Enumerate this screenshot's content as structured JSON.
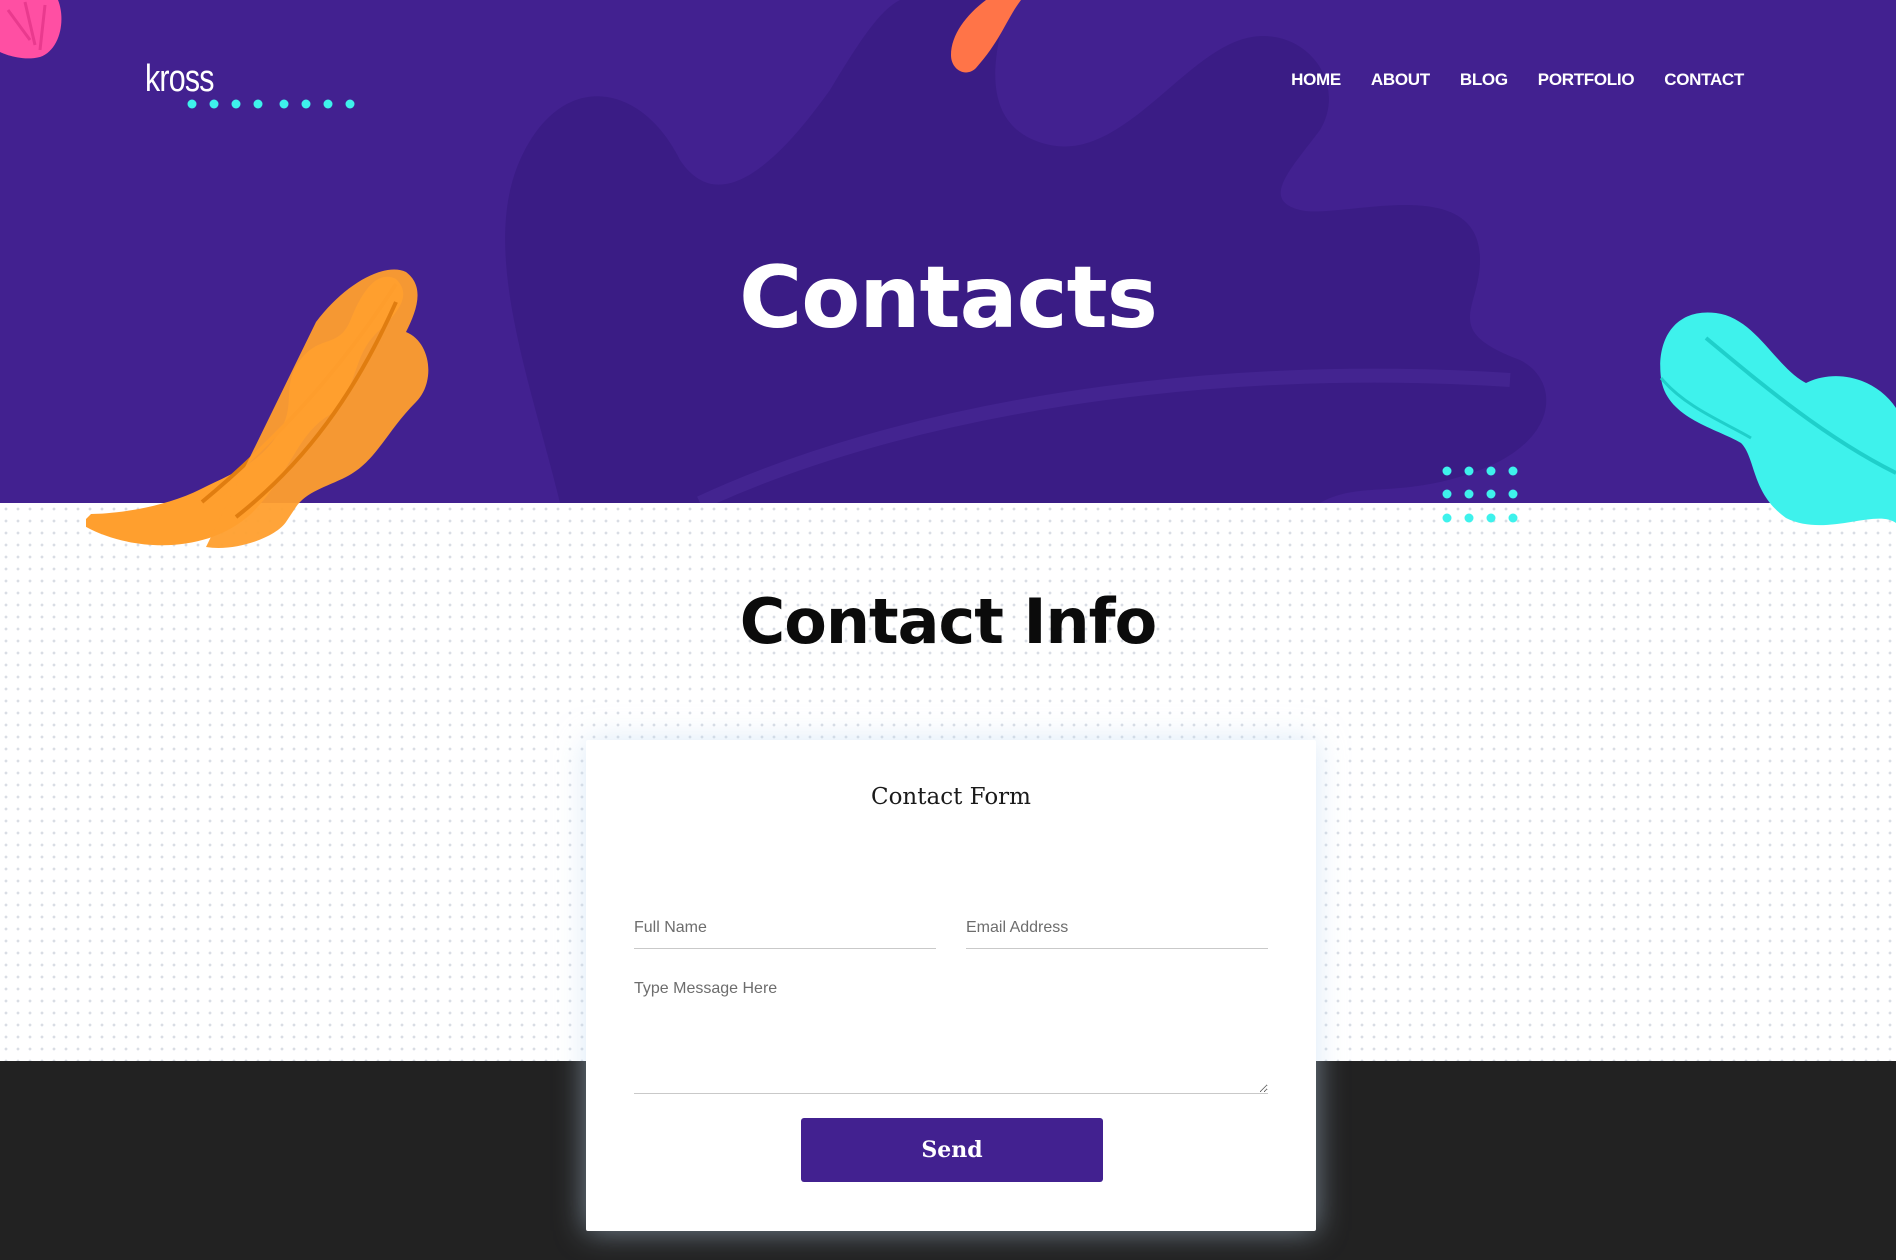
{
  "brand": {
    "logo_text": "kross"
  },
  "nav": {
    "items": [
      {
        "label": "HOME"
      },
      {
        "label": "ABOUT"
      },
      {
        "label": "BLOG"
      },
      {
        "label": "PORTFOLIO"
      },
      {
        "label": "CONTACT"
      }
    ]
  },
  "hero": {
    "title": "Contacts"
  },
  "contact_section": {
    "title": "Contact Info"
  },
  "contact_form": {
    "title": "Contact Form",
    "name_placeholder": "Full Name",
    "email_placeholder": "Email Address",
    "message_placeholder": "Type Message Here",
    "send_label": "Send"
  },
  "colors": {
    "hero_bg": "#422190",
    "accent_cyan": "#3EF2EC",
    "leaf_orange": "#FF9F2E",
    "leaf_pink": "#FF4FA3",
    "leaf_coral": "#FF7448",
    "button_bg": "#422190",
    "footer_bg": "#222222"
  }
}
